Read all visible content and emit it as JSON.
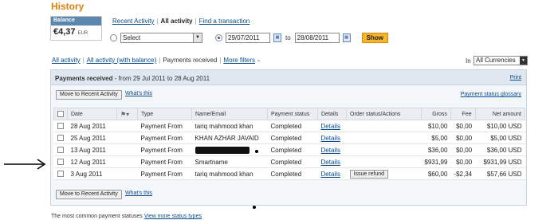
{
  "page_title": "History",
  "balance": {
    "label": "Balance",
    "amount": "€4,37",
    "currency": "EUR"
  },
  "view_tabs": [
    "Recent Activity",
    "All activity",
    "Find a transaction"
  ],
  "filter": {
    "select_value": "Select",
    "date_from": "29/07/2011",
    "to_label": "to",
    "date_to": "28/08/2011",
    "show_label": "Show"
  },
  "subtabs": {
    "all": "All activity",
    "all_balance": "All activity (with balance)",
    "payments_received": "Payments received",
    "more_filters": "More filters"
  },
  "currency": {
    "in_label": "In",
    "value": "All Currencies"
  },
  "panel": {
    "title_bold": "Payments received",
    "title_rest": " - from 29 Jul 2011 to 28 Aug 2011",
    "print": "Print",
    "move_button": "Move to Recent Activity",
    "whats_this": "What's this",
    "glossary": "Payment status glossary"
  },
  "table": {
    "headers": [
      "Date",
      "Type",
      "Name/Email",
      "Payment status",
      "Details",
      "Order status/Actions",
      "Gross",
      "Fee",
      "Net amount"
    ],
    "rows": [
      {
        "date": "28 Aug 2011",
        "type": "Payment From",
        "name": "tariq mahmood khan",
        "status": "Completed",
        "details": "Details",
        "action": "",
        "gross": "$10,00",
        "fee": "$0,00",
        "net": "$10,00 USD"
      },
      {
        "date": "25 Aug 2011",
        "type": "Payment From",
        "name": "KHAN AZHAR JAVAID",
        "status": "Completed",
        "details": "Details",
        "action": "",
        "gross": "$5,00",
        "fee": "$0,00",
        "net": "$5,00 USD"
      },
      {
        "date": "13 Aug 2011",
        "type": "Payment From",
        "name": "",
        "status": "Completed",
        "details": "Details",
        "action": "",
        "gross": "$36,00",
        "fee": "$0,00",
        "net": "$36,00 USD"
      },
      {
        "date": "12 Aug 2011",
        "type": "Payment From",
        "name": "Smartname",
        "status": "Completed",
        "details": "Details",
        "action": "",
        "gross": "$931,99",
        "fee": "$0,00",
        "net": "$931,99 USD"
      },
      {
        "date": "3 Aug 2011",
        "type": "Payment From",
        "name": "tariq mahmood khan",
        "status": "Completed",
        "details": "Details",
        "action": "Issue refund",
        "gross": "$60,00",
        "fee": "-$2,34",
        "net": "$57,66 USD"
      }
    ]
  },
  "footer": {
    "common_text": "The most common payment statuses",
    "more_link": "View more status types"
  },
  "icons": {
    "calendar": "calendar-icon",
    "flag": "flag-icon",
    "arrow": "arrow-right-icon"
  },
  "colors": {
    "title": "#e07f0c",
    "link": "#084b8a",
    "show_button": "#f7b42c",
    "balance_head": "#5b86ad"
  }
}
